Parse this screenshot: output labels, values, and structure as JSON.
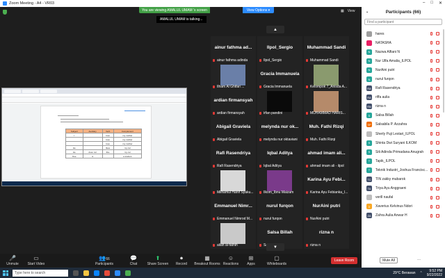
{
  "window": {
    "title": "Zoom Meeting - A4 - VR03",
    "controls": [
      "–",
      "□",
      "✕"
    ]
  },
  "banner": {
    "viewing": "You are viewing AMALUL UMAM 's screen",
    "view_options": "View Options ▾"
  },
  "talking": "AMALUL UMAM is talking...",
  "top_right": {
    "view": "View"
  },
  "shared_doc": {
    "table_header": [
      "Subject",
      "Auxiliary",
      "Verb",
      "Complement"
    ],
    "table_rows": [
      [
        "I",
        "",
        "love",
        "my mother"
      ],
      [
        "",
        "",
        "love",
        "my mother"
      ],
      [
        "",
        "",
        "love",
        "my mother"
      ],
      [
        "He",
        "",
        "likes",
        "my car"
      ],
      [
        "He",
        "does not",
        "like",
        "my car"
      ],
      [
        "Doe",
        "is",
        "",
        "a student"
      ]
    ]
  },
  "tiles": [
    {
      "name": "ainur fathma ad...",
      "label": "ainur fathma adinda",
      "photo": false
    },
    {
      "name": "Ilpol_Sergio",
      "label": "Ilpol_Sergio",
      "photo": false
    },
    {
      "name": "Muhammad Sandi",
      "label": "Muhammad Sandi",
      "photo": false
    },
    {
      "name": "",
      "label": "Ilham Al Ghifari ...",
      "photo": true,
      "photo_color": "#6a7fa8"
    },
    {
      "name": "Gracia Immanuela",
      "label": "Gracia Immanuela",
      "photo": false
    },
    {
      "name": "",
      "label": "Kelompok 7_Anisda A...",
      "photo": true,
      "photo_color": "#8a9a6e"
    },
    {
      "name": "ardian firmansyah",
      "label": "ardian firmansyah",
      "photo": false
    },
    {
      "name": "",
      "label": "irfan pandini",
      "photo": true,
      "photo_color": "#0a0a0a"
    },
    {
      "name": "",
      "label": "MUHAMMAD HARIS...",
      "photo": true,
      "photo_color": "#b58a6a"
    },
    {
      "name": "Abigail Graviela",
      "label": "Abigail Graviela",
      "photo": false
    },
    {
      "name": "melynda nur ok...",
      "label": "melynda nur oktaviani",
      "photo": false
    },
    {
      "name": "Muh. Fathi Rizqi",
      "label": "Muh. Fathi Rizqi",
      "photo": false
    },
    {
      "name": "Rafi Rasendriya",
      "label": "Rafi Rasendriya",
      "photo": false
    },
    {
      "name": "Iqbal Aditya",
      "label": "Iqbal Aditya",
      "photo": false
    },
    {
      "name": "ahmad imam ali...",
      "label": "ahmad imam ali - ilpol",
      "photo": false
    },
    {
      "name": "",
      "label": "Milhamul Hanif Syaku...",
      "photo": true,
      "photo_color": "#d8d8d8"
    },
    {
      "name": "",
      "label": "Ilkom_Ibnu Maizam",
      "photo": true,
      "photo_color": "#7a3a8a"
    },
    {
      "name": "Karina Ayu Febi...",
      "label": "Karina Ayu Febianka_I...",
      "photo": false
    },
    {
      "name": "Emmanuel Nimr...",
      "label": "Emmanuel Nimrod M...",
      "photo": false
    },
    {
      "name": "nurul furqon",
      "label": "nurul furqon",
      "photo": false
    },
    {
      "name": "NurAini putri",
      "label": "NurAini putri",
      "photo": false
    },
    {
      "name": "",
      "label": "aliah al-fathih",
      "photo": true,
      "photo_color": "#c9c9c9"
    },
    {
      "name": "Salsa Billah",
      "label": "Salsa Billah",
      "photo": false
    },
    {
      "name": "rizna n",
      "label": "rizna n",
      "photo": false
    }
  ],
  "participants": {
    "title": "Participants (66)",
    "search_placeholder": "Find a participant",
    "list": [
      {
        "initial": "",
        "name": "hares",
        "color": "#9e9e9e"
      },
      {
        "initial": "",
        "name": "NATASHA",
        "color": "#e91e63"
      },
      {
        "initial": "N",
        "name": "Nazwa Alfiani N",
        "color": "#26a69a"
      },
      {
        "initial": "N",
        "name": "Nur Ulfa Amalia_ILPOL",
        "color": "#26a69a"
      },
      {
        "initial": "N",
        "name": "NurAini putri",
        "color": "#26a69a"
      },
      {
        "initial": "N",
        "name": "nurul furqon",
        "color": "#26a69a"
      },
      {
        "initial": "RA",
        "name": "Rafi Rasendriya",
        "color": "#424f6a"
      },
      {
        "initial": "RA",
        "name": "riffa aulia",
        "color": "#424f6a"
      },
      {
        "initial": "RN",
        "name": "rizna n",
        "color": "#424f6a"
      },
      {
        "initial": "S",
        "name": "Salsa Billah",
        "color": "#26a69a"
      },
      {
        "initial": "SP",
        "name": "Salsabila P. Azzahra",
        "color": "#ef6c00"
      },
      {
        "initial": "",
        "name": "Sherly Puji Lestari_ILPOL",
        "color": "#bdbdbd"
      },
      {
        "initial": "S",
        "name": "Shinta Dwi Suryani ILKOM",
        "color": "#26a69a"
      },
      {
        "initial": "S",
        "name": "Siti Adinda Primadana Anugrah",
        "color": "#26a69a"
      },
      {
        "initial": "T",
        "name": "Tapik_ILPOL",
        "color": "#26a69a"
      },
      {
        "initial": "T",
        "name": "Teknik Industri_Joshua Francisc...",
        "color": "#26a69a"
      },
      {
        "initial": "TC",
        "name": "TIN zakky mubarok",
        "color": "#424f6a"
      },
      {
        "initial": "TA",
        "name": "Triya Ayu Anggraeni",
        "color": "#424f6a"
      },
      {
        "initial": "",
        "name": "verill naufal",
        "color": "#bdbdbd"
      },
      {
        "initial": "X",
        "name": "Xaverius Kelvinus Ndori",
        "color": "#f9a825"
      },
      {
        "initial": "ZA",
        "name": "Zahra Aulia Anwar H",
        "color": "#424f6a"
      }
    ],
    "mute_all": "Mute All",
    "more": "..."
  },
  "toolbar": {
    "unmute": "Unmute",
    "start_video": "Start Video",
    "participants": "Participants",
    "participants_count": "66",
    "chat": "Chat",
    "share_screen": "Share Screen",
    "record": "Record",
    "breakout": "Breakout Rooms",
    "reactions": "Reactions",
    "apps": "Apps",
    "whiteboards": "Whiteboards",
    "leave": "Leave Room"
  },
  "taskbar": {
    "search": "Type here to search",
    "weather": "29°C Berawan",
    "time": "9:52 PM",
    "date": "9/22/2022"
  }
}
